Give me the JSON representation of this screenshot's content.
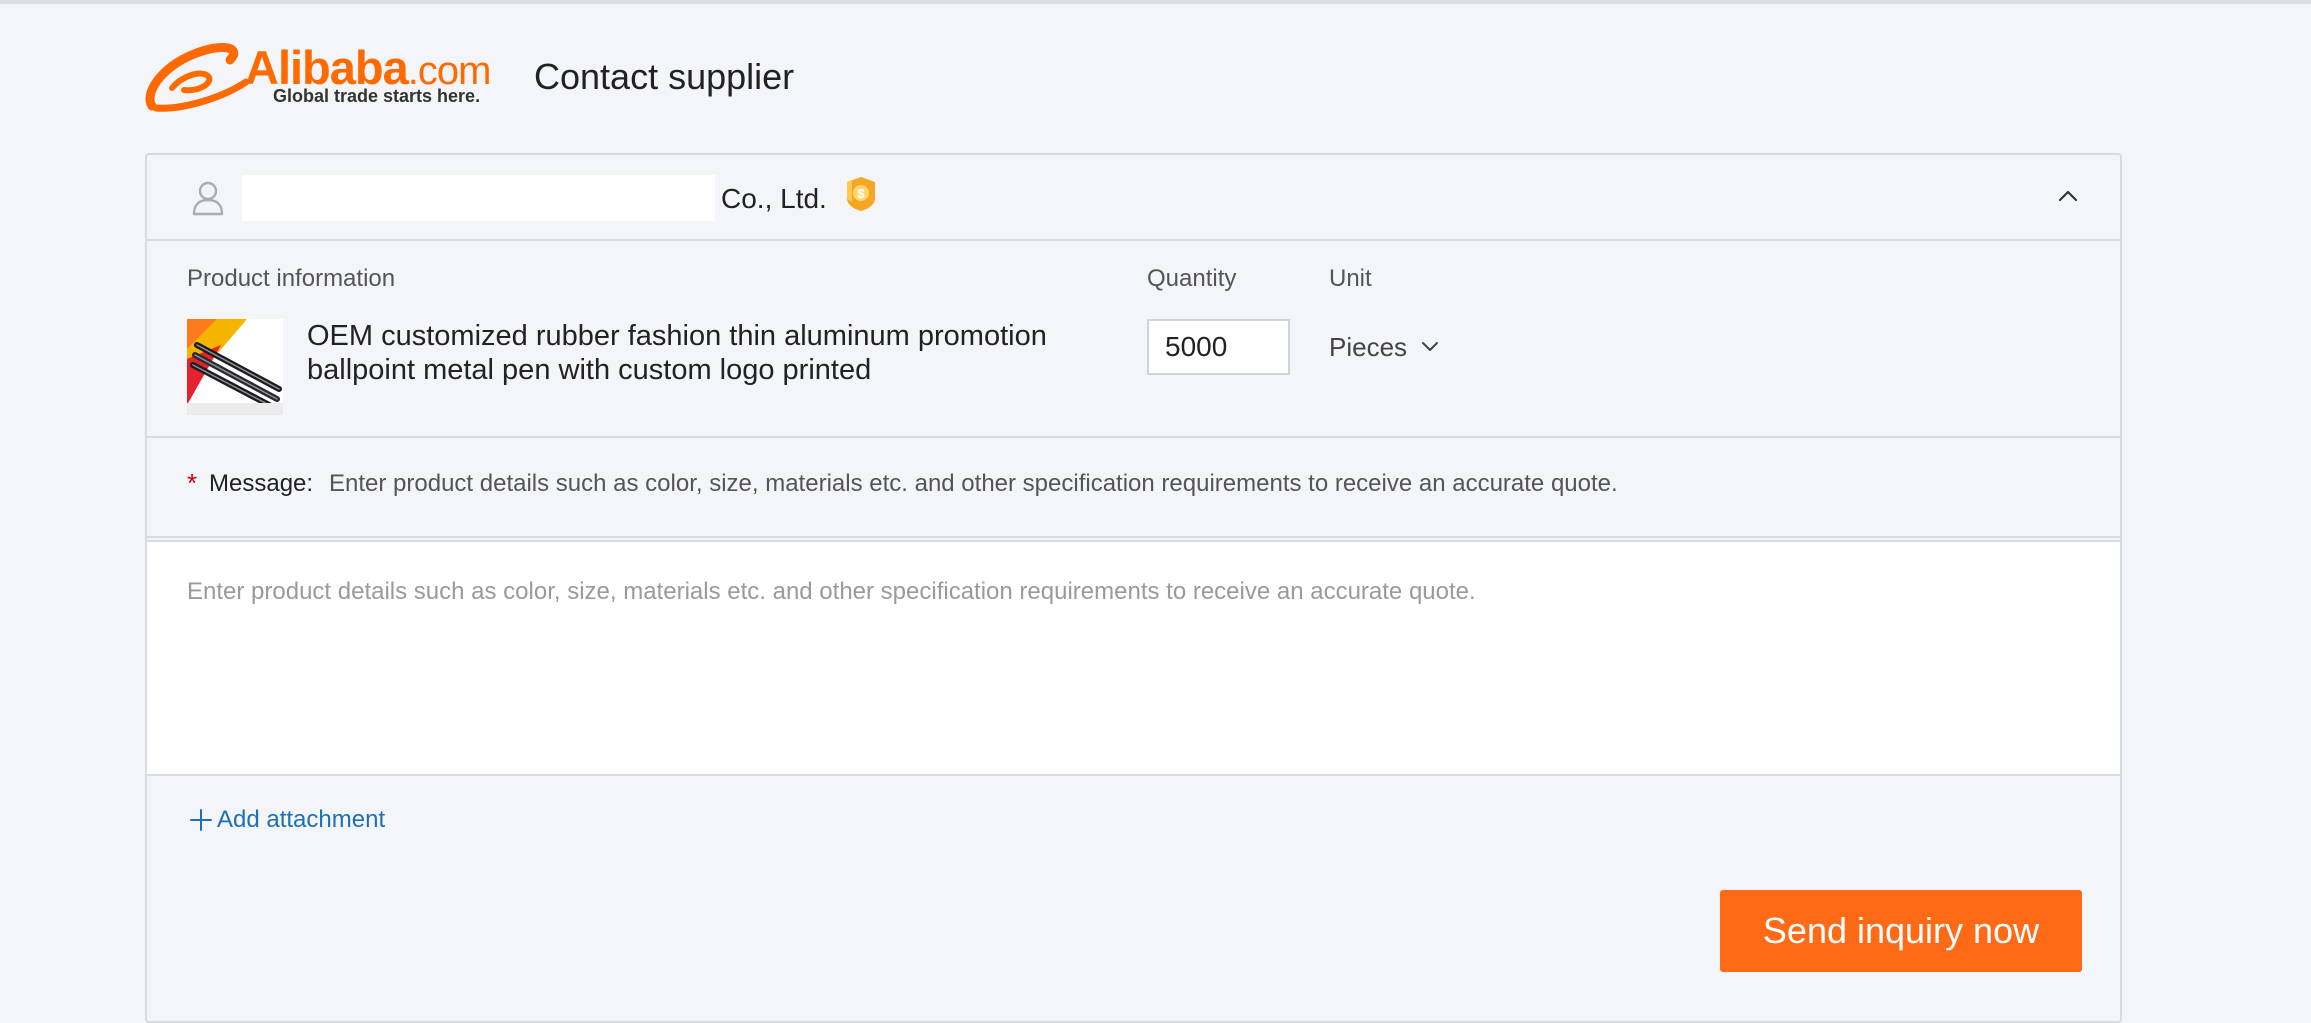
{
  "header": {
    "logo_word": "Alibaba",
    "logo_dotcom": ".com",
    "logo_tagline": "Global trade starts here.",
    "title": "Contact supplier"
  },
  "supplier": {
    "name_suffix": "Co., Ltd.",
    "person_icon": "user-icon",
    "badge_icon": "gold-supplier-badge-icon",
    "collapse_icon": "chevron-up-icon"
  },
  "product": {
    "info_label": "Product information",
    "quantity_label": "Quantity",
    "unit_label": "Unit",
    "name": "OEM customized rubber fashion thin aluminum promotion ballpoint metal pen with custom logo printed",
    "quantity_value": "5000",
    "unit_value": "Pieces"
  },
  "message": {
    "required_mark": "*",
    "label": "Message:",
    "hint": "Enter product details such as color, size, materials etc. and other specification requirements to receive an accurate quote.",
    "placeholder": "Enter product details such as color, size, materials etc. and other specification requirements to receive an accurate quote."
  },
  "attachment": {
    "label": "Add attachment"
  },
  "actions": {
    "send_label": "Send inquiry now"
  },
  "colors": {
    "brand_orange": "#ff6a00",
    "button_orange": "#ff6a17",
    "link_blue": "#1d6fb6",
    "required_red": "#c8000a",
    "badge_gold": "#f5a623"
  }
}
